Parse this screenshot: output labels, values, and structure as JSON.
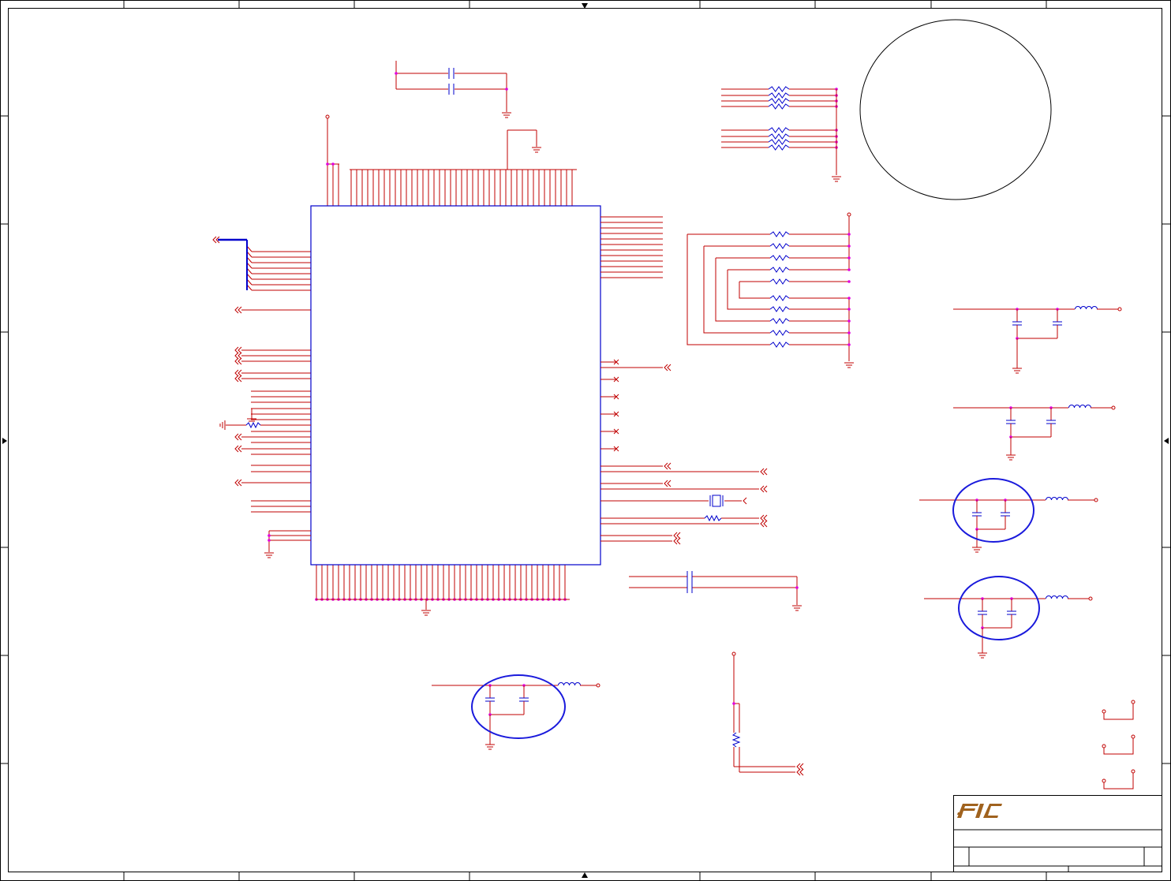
{
  "sheet": {
    "title_block": {
      "logo": "FIC"
    }
  },
  "colors": {
    "wire": "#c00000",
    "component": "#0000cc",
    "junction": "#e000e0",
    "highlight_ring": "#1a1adc",
    "border": "#000000",
    "logo": "#a0621e"
  }
}
